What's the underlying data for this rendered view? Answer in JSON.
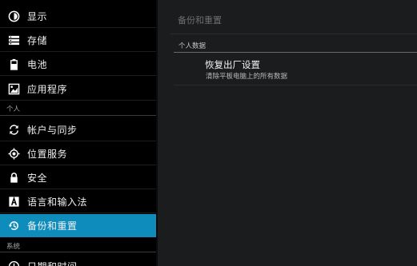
{
  "sidebar": {
    "items": [
      {
        "label": "显示",
        "icon": "brightness-icon"
      },
      {
        "label": "存储",
        "icon": "storage-icon"
      },
      {
        "label": "电池",
        "icon": "battery-icon"
      },
      {
        "label": "应用程序",
        "icon": "apps-icon"
      },
      {
        "label": "帐户与同步",
        "icon": "sync-icon"
      },
      {
        "label": "位置服务",
        "icon": "location-icon"
      },
      {
        "label": "安全",
        "icon": "lock-icon"
      },
      {
        "label": "语言和输入法",
        "icon": "keyboard-a-icon"
      },
      {
        "label": "备份和重置",
        "icon": "backup-restore-icon",
        "selected": true
      },
      {
        "label": "日期和时间",
        "icon": "clock-icon"
      }
    ],
    "sections": {
      "personal": "个人",
      "system": "系统"
    }
  },
  "main": {
    "title": "备份和重置",
    "section_header": "个人数据",
    "factory_reset": {
      "title": "恢复出厂设置",
      "summary": "清除平板电脑上的所有数据"
    }
  },
  "colors": {
    "accent": "#0e8dbc",
    "background": "#000000",
    "panel": "#1b1c1e"
  }
}
